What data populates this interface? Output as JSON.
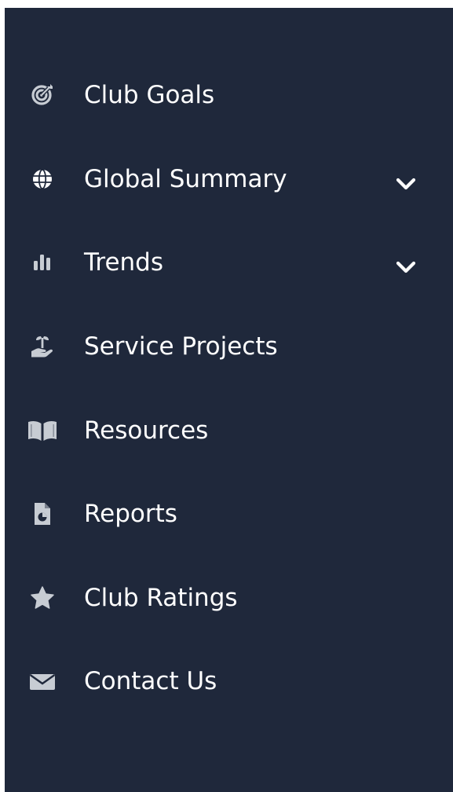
{
  "sidebar": {
    "background": "#1f283b",
    "icon_color": "#c7ccd3",
    "text_color": "#ffffff",
    "items": [
      {
        "label": "Club Goals",
        "icon": "target-icon",
        "expandable": false
      },
      {
        "label": "Global Summary",
        "icon": "globe-icon",
        "expandable": true
      },
      {
        "label": "Trends",
        "icon": "bar-chart-icon",
        "expandable": true
      },
      {
        "label": "Service Projects",
        "icon": "seedling-hand-icon",
        "expandable": false
      },
      {
        "label": "Resources",
        "icon": "book-open-icon",
        "expandable": false
      },
      {
        "label": "Reports",
        "icon": "file-chart-icon",
        "expandable": false
      },
      {
        "label": "Club Ratings",
        "icon": "star-icon",
        "expandable": false
      },
      {
        "label": "Contact Us",
        "icon": "envelope-icon",
        "expandable": false
      }
    ]
  }
}
